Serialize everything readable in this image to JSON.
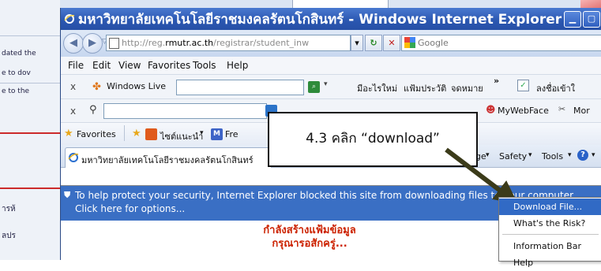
{
  "window": {
    "title": "มหาวิทยาลัยเทคโนโลยีราชมงคลรัตนโกสินทร์ - Windows Internet Explorer"
  },
  "address_bar": {
    "url_prefix": "http://reg.",
    "url_host": "rmutr.ac.th",
    "url_rest": "/registrar/student_inw"
  },
  "search": {
    "placeholder": "Google"
  },
  "menu": {
    "items": [
      "File",
      "Edit",
      "View",
      "Favorites",
      "Tools",
      "Help"
    ]
  },
  "toolbar_windows_live": {
    "label": "Windows Live",
    "items": [
      "มีอะไรใหม่",
      "แฟ้มประวัติ",
      "จดหมาย"
    ],
    "overflow": "»",
    "signin": "ลงชื่อเข้าใ"
  },
  "toolbar_mywebface": {
    "mywebface": "MyWebFace",
    "more": "Mor"
  },
  "favorites_bar": {
    "favorites": "Favorites",
    "suggested": "ไซต์แนะนำ",
    "free": "Fre"
  },
  "tab": {
    "title": "มหาวิทยาลัยเทคโนโลยีราชมงคลรัตนโกสินทร์"
  },
  "command_bar": {
    "page": "Page",
    "safety": "Safety",
    "tools": "Tools"
  },
  "info_bar": {
    "message": "To help protect your security, Internet Explorer blocked this site from downloading files to your computer. Click here for options..."
  },
  "page": {
    "loading_line1": "กำลังสร้างแฟ้มข้อมูล",
    "loading_line2": "กรุณารอสักครู่..."
  },
  "callout": {
    "text": "4.3 คลิก “download”"
  },
  "context_menu": {
    "items": [
      "Download File...",
      "What's the Risk?",
      "Information Bar Help"
    ]
  },
  "background_fragments": [
    "dated the",
    "e to dov",
    "e to the",
    "ารห้",
    "ลปร"
  ],
  "colors": {
    "titlebar": "#2a56b0",
    "info_bar": "#3a6fc4",
    "menu_selection": "#316ac5",
    "loading_text": "#cc2200",
    "arrow": "#3b3b1a"
  }
}
